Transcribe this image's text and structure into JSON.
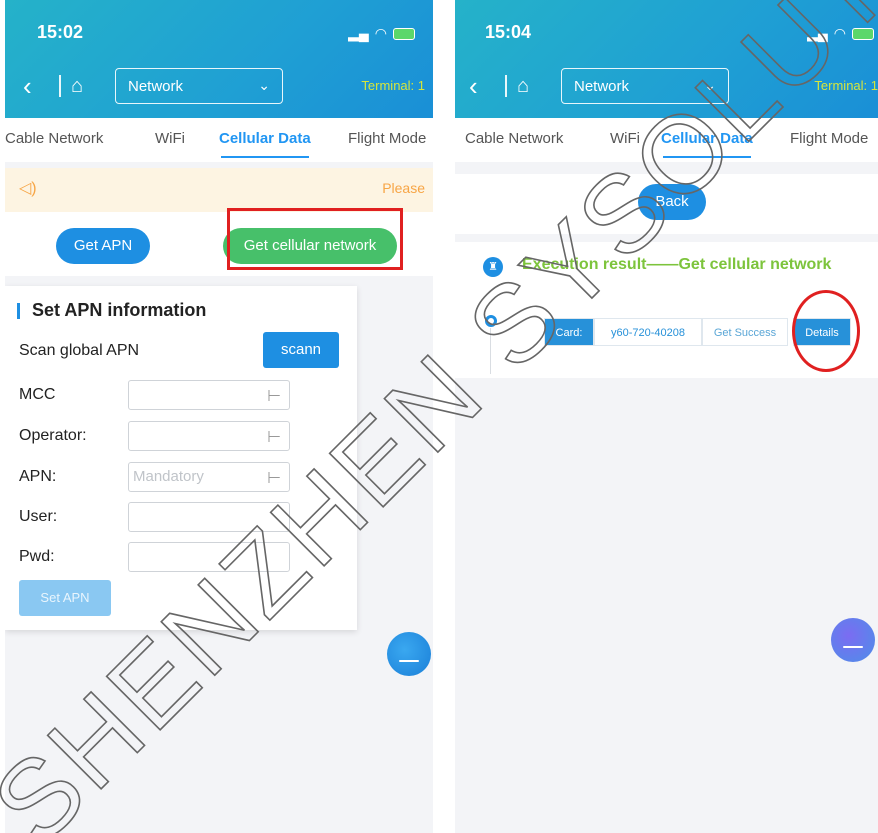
{
  "left_screen": {
    "status_time": "15:02",
    "terminal_text": "Terminal: 1",
    "nav_select": "Network",
    "tabs": [
      "Cable Network",
      "WiFi",
      "Cellular Data",
      "Flight Mode"
    ],
    "active_tab": "Cellular Data",
    "notice_text": "Please",
    "get_apn_label": "Get APN",
    "get_cellular_label": "Get cellular network",
    "form": {
      "title": "Set APN information",
      "scan_label": "Scan global APN",
      "scan_button": "scann",
      "mcc_label": "MCC",
      "operator_label": "Operator:",
      "apn_label": "APN:",
      "apn_placeholder": "Mandatory",
      "user_label": "User:",
      "pwd_label": "Pwd:",
      "set_apn_button": "Set APN"
    }
  },
  "right_screen": {
    "status_time": "15:04",
    "terminal_text": "Terminal: 1",
    "nav_select": "Network",
    "tabs": [
      "Cable Network",
      "WiFi",
      "Cellular Data",
      "Flight Mode"
    ],
    "active_tab": "Cellular Data",
    "back_label": "Back",
    "result_title": "Execution result——Get cellular network",
    "result_row": {
      "card_label": "Card:",
      "card_value": "y60-720-40208",
      "status": "Get Success",
      "details_button": "Details"
    }
  },
  "watermark": "SHENZHEN SYSOLUTION TECHNOLOGY",
  "colors": {
    "header": "#1f9fd4",
    "primary_blue": "#1e8fe2",
    "green_button": "#47c06a",
    "highlight_red": "#e02020",
    "result_title_green": "#7dc43c"
  }
}
